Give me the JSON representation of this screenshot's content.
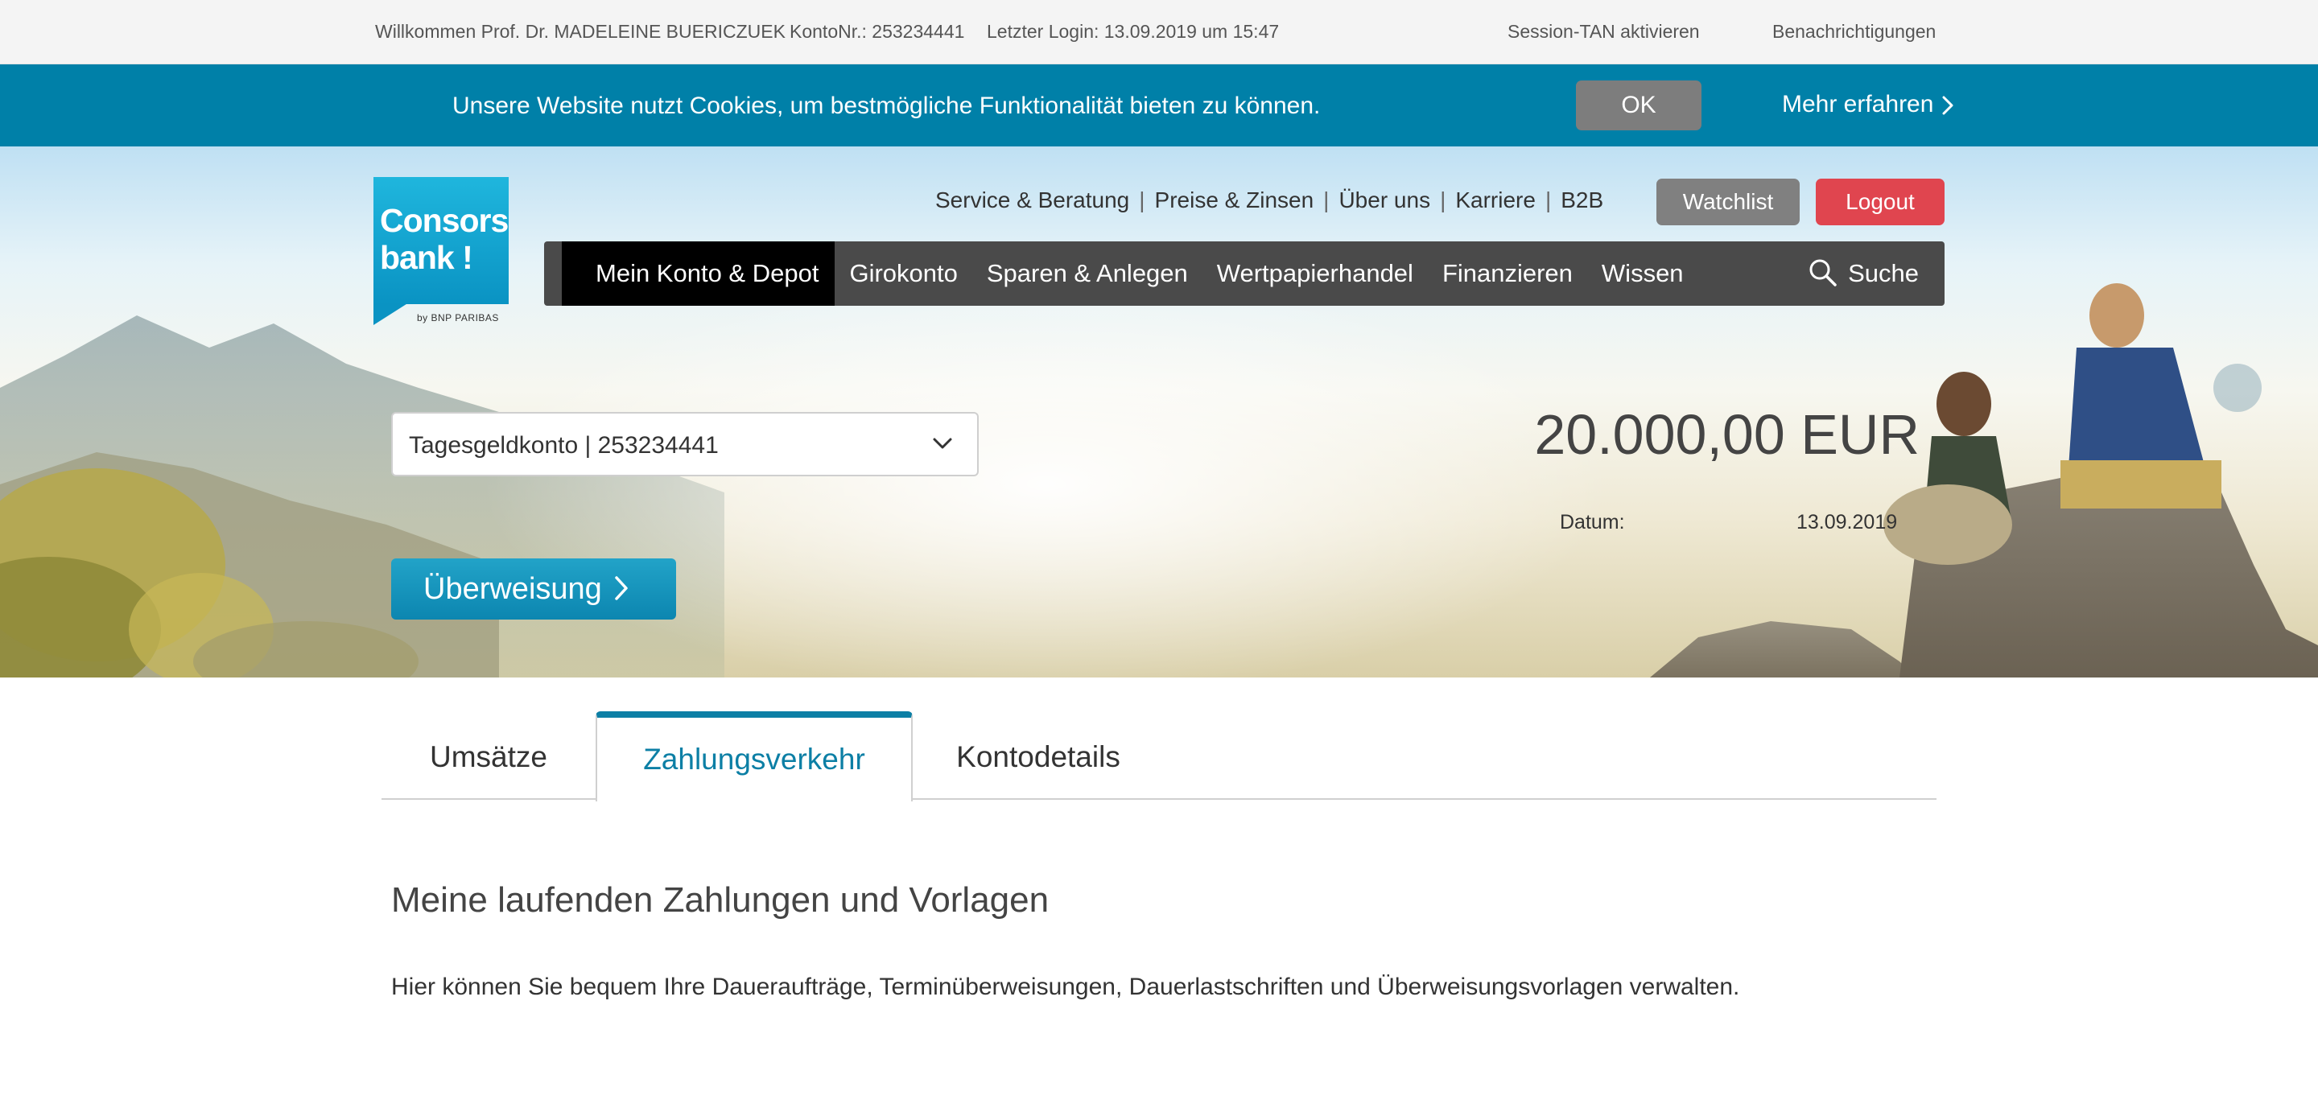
{
  "topbar": {
    "welcome": "Willkommen Prof. Dr. MADELEINE BUERICZUEK",
    "konto": "KontoNr.: 253234441",
    "last_login": "Letzter Login: 13.09.2019 um 15:47",
    "session_tan": "Session-TAN aktivieren",
    "notifications": "Benachrichtigungen"
  },
  "cookie": {
    "message": "Unsere Website nutzt Cookies, um bestmögliche Funktionalität bieten zu können.",
    "ok_label": "OK",
    "more_label": "Mehr erfahren"
  },
  "logo": {
    "line1": "Consors",
    "line2": "bank !",
    "byline": "by BNP PARIBAS"
  },
  "service_nav": [
    "Service & Beratung",
    "Preise & Zinsen",
    "Über uns",
    "Karriere",
    "B2B"
  ],
  "buttons": {
    "watchlist": "Watchlist",
    "logout": "Logout"
  },
  "main_nav": {
    "items": [
      "Mein Konto & Depot",
      "Girokonto",
      "Sparen & Anlegen",
      "Wertpapierhandel",
      "Finanzieren",
      "Wissen"
    ],
    "search_label": "Suche"
  },
  "account": {
    "selected": "Tagesgeldkonto | 253234441",
    "balance": "20.000,00 EUR",
    "date_label": "Datum:",
    "date_value": "13.09.2019",
    "transfer_label": "Überweisung"
  },
  "tabs": [
    "Umsätze",
    "Zahlungsverkehr",
    "Kontodetails"
  ],
  "content": {
    "heading": "Meine laufenden Zahlungen und Vorlagen",
    "description": "Hier können Sie bequem Ihre Daueraufträge, Terminüberweisungen, Dauerlastschriften und Überweisungsvorlagen verwalten."
  },
  "colors": {
    "brand_blue": "#0080a8",
    "logout_red": "#e0454f",
    "nav_dark": "#4a4a4a",
    "active_tab": "#0c7fa5"
  }
}
